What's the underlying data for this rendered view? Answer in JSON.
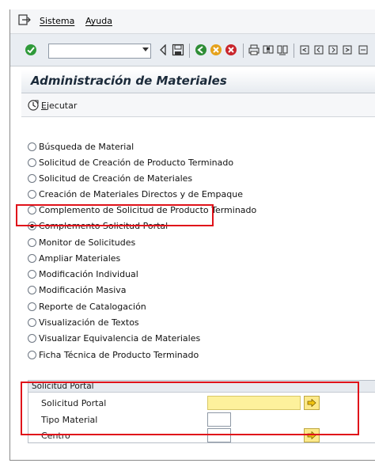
{
  "menu": {
    "items": [
      "Sistema",
      "Ayuda"
    ]
  },
  "toolbar": {
    "command_field_value": "",
    "icons": [
      "enter-icon",
      "back-icon",
      "save-icon",
      "back-green-icon",
      "exit-icon",
      "cancel-icon",
      "print-icon",
      "find-icon",
      "find-next-icon",
      "first-page-icon",
      "prev-page-icon",
      "next-page-icon",
      "last-page-icon"
    ]
  },
  "title": "Administración de Materiales",
  "app_toolbar": {
    "execute_hotkey": "E",
    "execute_rest": "jecutar"
  },
  "options": [
    {
      "label": "Búsqueda de Material",
      "checked": false
    },
    {
      "label": "Solicitud de Creación de Producto Terminado",
      "checked": false
    },
    {
      "label": "Solicitud de Creación de Materiales",
      "checked": false
    },
    {
      "label": "Creación de Materiales Directos y de Empaque",
      "checked": false
    },
    {
      "label": "Complemento de Solicitud de Producto Terminado",
      "checked": false
    },
    {
      "label": "Complemento Solicitud Portal",
      "checked": true
    },
    {
      "label": "Monitor de Solicitudes",
      "checked": false
    },
    {
      "label": "Ampliar Materiales",
      "checked": false
    },
    {
      "label": "Modificación Individual",
      "checked": false
    },
    {
      "label": "Modificación Masiva",
      "checked": false
    },
    {
      "label": "Reporte de Catalogación",
      "checked": false
    },
    {
      "label": "Visualización de Textos",
      "checked": false
    },
    {
      "label": "Visualizar Equivalencia de Materiales",
      "checked": false
    },
    {
      "label": "Ficha Técnica de Producto Terminado",
      "checked": false
    }
  ],
  "group": {
    "title": "Solicitud Portal",
    "fields": {
      "solicitud_portal": {
        "label": "Solicitud Portal",
        "value": ""
      },
      "tipo_material": {
        "label": "Tipo Material",
        "value": ""
      },
      "centro": {
        "label": "Centro",
        "value": ""
      }
    }
  },
  "colors": {
    "highlight": "#e0121a",
    "active_field": "#fdf19c",
    "toolbar_bg": "#e9edf2"
  }
}
